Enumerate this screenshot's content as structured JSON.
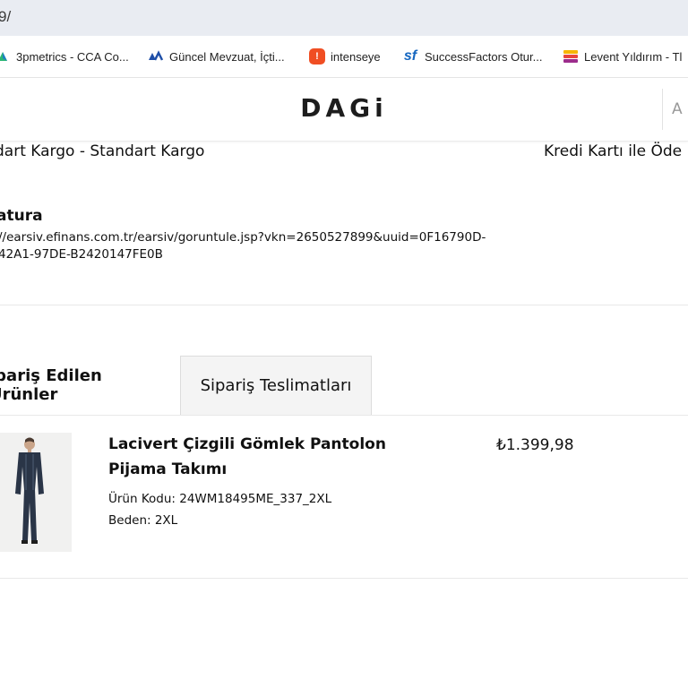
{
  "browser": {
    "url_fragment": "9/"
  },
  "bookmarks": [
    {
      "label": "3pmetrics - CCA Co...",
      "icon": "3pmetrics-icon"
    },
    {
      "label": "Güncel Mevzuat, İçti...",
      "icon": "mevzuat-icon"
    },
    {
      "label": "intenseye",
      "icon": "intenseye-icon"
    },
    {
      "label": "SuccessFactors Otur...",
      "icon": "successfactors-icon"
    },
    {
      "label": "Levent Yıldırım - Tl",
      "icon": "stack-icon"
    }
  ],
  "header": {
    "logo": "DAGi",
    "right_letter": "A"
  },
  "order": {
    "shipping": "dart Kargo - Standart Kargo",
    "payment": "Kredi Kartı ile Öde",
    "invoice_title": "atura",
    "invoice_link_line1": "//earsiv.efinans.com.tr/earsiv/goruntule.jsp?vkn=2650527899&uuid=0F16790D-",
    "invoice_link_line2": "42A1-97DE-B2420147FE0B"
  },
  "tabs": [
    {
      "label": "ipariş Edilen Ürünler",
      "active": true
    },
    {
      "label": "Sipariş Teslimatları",
      "active": false
    }
  ],
  "product": {
    "name_line1": "Lacivert Çizgili Gömlek Pantolon",
    "name_line2": "Pijama Takımı",
    "code": "Ürün Kodu: 24WM18495ME_337_2XL",
    "size": "Beden: 2XL",
    "price": "₺1.399,98"
  }
}
